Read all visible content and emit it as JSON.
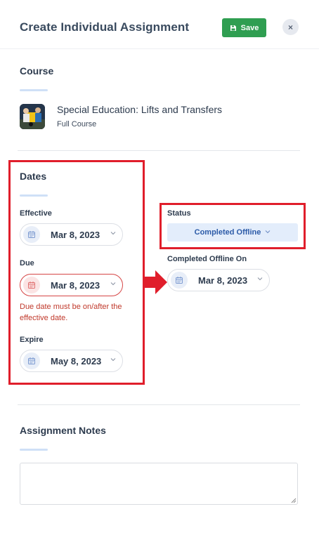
{
  "header": {
    "title": "Create Individual Assignment",
    "save_label": "Save",
    "close_symbol": "×"
  },
  "course": {
    "heading": "Course",
    "title": "Special Education: Lifts and Transfers",
    "subtitle": "Full Course"
  },
  "dates": {
    "heading": "Dates",
    "effective": {
      "label": "Effective",
      "value": "Mar 8, 2023"
    },
    "due": {
      "label": "Due",
      "value": "Mar 8, 2023",
      "error": "Due date must be on/after the effective date."
    },
    "expire": {
      "label": "Expire",
      "value": "May 8, 2023"
    }
  },
  "status": {
    "label": "Status",
    "value": "Completed Offline",
    "completed_on_label": "Completed Offline On",
    "completed_on_value": "Mar 8, 2023"
  },
  "notes": {
    "heading": "Assignment Notes",
    "value": ""
  },
  "colors": {
    "save_green": "#2f9e51",
    "highlight_red": "#e01e2b",
    "error_red": "#d64545",
    "status_bg": "#e3edfb"
  },
  "icons": [
    "save-icon",
    "close-icon",
    "calendar-icon",
    "chevron-down-icon",
    "arrow-right-icon"
  ]
}
